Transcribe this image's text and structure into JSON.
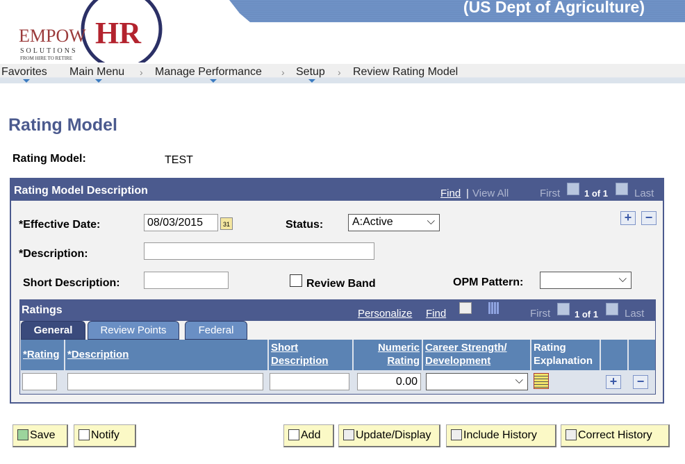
{
  "header": {
    "agency": "(US Dept of Agriculture)",
    "logo_text": "EMPOWHR SOLUTIONS FROM HIRE TO RETIRE"
  },
  "nav": {
    "favorites": "Favorites",
    "main_menu": "Main Menu",
    "manage_performance": "Manage Performance",
    "setup": "Setup",
    "current": "Review Rating Model"
  },
  "page": {
    "title": "Rating Model",
    "rating_model_label": "Rating Model:",
    "rating_model_value": "TEST"
  },
  "description_box": {
    "title": "Rating Model Description",
    "find": "Find",
    "view_all": "View All",
    "first": "First",
    "count": "1 of 1",
    "last": "Last",
    "effective_date_label": "*Effective Date:",
    "effective_date": "08/03/2015",
    "status_label": "Status:",
    "status": "A:Active",
    "description_label": "*Description:",
    "description": "",
    "short_description_label": "Short Description:",
    "short_description": "",
    "review_band_label": "Review Band",
    "review_band_checked": false,
    "opm_pattern_label": "OPM Pattern:",
    "opm_pattern": ""
  },
  "ratings": {
    "title": "Ratings",
    "personalize": "Personalize",
    "find": "Find",
    "first": "First",
    "count": "1 of 1",
    "last": "Last",
    "tabs": [
      "General",
      "Review Points",
      "Federal"
    ],
    "active_tab": "General",
    "columns": [
      "*Rating",
      "*Description",
      "Short Description",
      "Numeric Rating",
      "Career Strength/ Development",
      "Rating Explanation"
    ],
    "row": {
      "rating": "",
      "description": "",
      "short_description": "",
      "numeric_rating": "0.00",
      "career_strength": ""
    }
  },
  "buttons": {
    "save": "Save",
    "notify": "Notify",
    "add": "Add",
    "update_display": "Update/Display",
    "include_history": "Include History",
    "correct_history": "Correct History"
  }
}
